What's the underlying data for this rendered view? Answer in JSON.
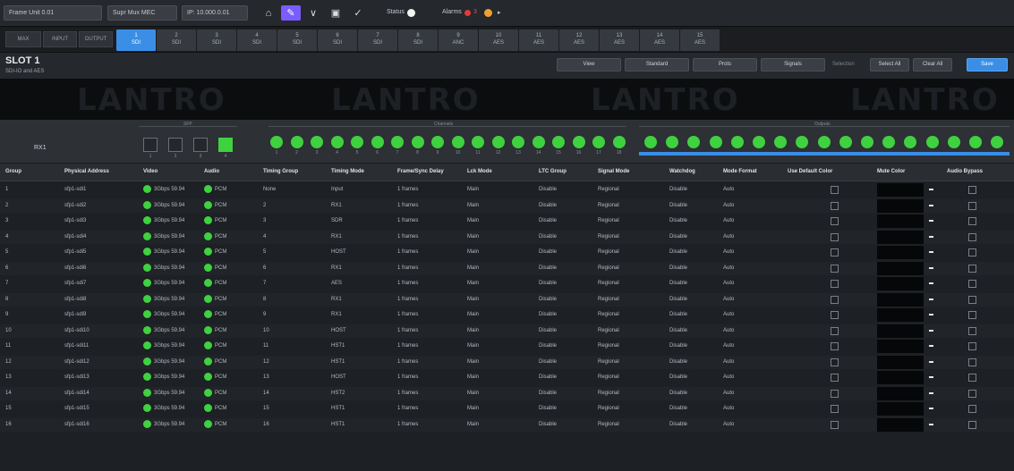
{
  "toolbar": {
    "device": "Frame Unit 0.01",
    "card": "Supr Mux MEC",
    "ip": "IP: 10.000.0.01",
    "status_label": "Status",
    "alarms_label": "Alarms",
    "alarm_count": "3",
    "buttons": [
      "home-icon",
      "pen-icon",
      "filter-icon",
      "camera-icon",
      "wrench-icon"
    ]
  },
  "inputs": {
    "left_buttons": [
      "MAX",
      "INPUT",
      "OUTPUT"
    ],
    "tabs": [
      {
        "num": "1",
        "label": "SDI"
      },
      {
        "num": "2",
        "label": "SDI"
      },
      {
        "num": "3",
        "label": "SDI"
      },
      {
        "num": "4",
        "label": "SDI"
      },
      {
        "num": "5",
        "label": "SDI"
      },
      {
        "num": "6",
        "label": "SDI"
      },
      {
        "num": "7",
        "label": "SDI"
      },
      {
        "num": "8",
        "label": "SDI"
      },
      {
        "num": "9",
        "label": "ANC"
      },
      {
        "num": "10",
        "label": "AES"
      },
      {
        "num": "11",
        "label": "AES"
      },
      {
        "num": "12",
        "label": "AES"
      },
      {
        "num": "13",
        "label": "AES"
      },
      {
        "num": "14",
        "label": "AES"
      },
      {
        "num": "15",
        "label": "AES"
      }
    ]
  },
  "slot": {
    "title": "SLOT 1",
    "subtitle": "SDI-IO and AES",
    "views": [
      "View",
      "Standard",
      "Prots",
      "Signals"
    ],
    "selection_label": "Selection",
    "select_all": "Select All",
    "clear_all": "Clear All",
    "apply": "Save"
  },
  "watermark": [
    "LANTRO",
    "LANTRO",
    "LANTRO",
    "LANTRO"
  ],
  "ports": {
    "rx_label": "RX1",
    "group_labels": [
      "SFP",
      "Channels",
      "Outputs"
    ],
    "sfp_count": 4,
    "sfp_active_index": 3,
    "channel_count": 18,
    "output_count": 17
  },
  "table": {
    "columns": [
      "Group",
      "Physical Address",
      "Video",
      "Audio",
      "Timing Group",
      "Timing Mode",
      "Frame/Sync Delay",
      "Lck Mode",
      "LTC Group",
      "Signal Mode",
      "Watchdog",
      "Mode Format",
      "Use Default Color",
      "Mute Color",
      "Audio Bypass"
    ],
    "rows": [
      {
        "group": "1",
        "addr": "sfp1-sdi1",
        "video": "3Gbps 59.94",
        "audio": "PCM",
        "tgroup": "None",
        "tmode": "Input",
        "fsd": "1 frames",
        "lck": "Main",
        "ltc": "Disable",
        "signal": "Regional",
        "watchdog": "Disable",
        "format": "Auto"
      },
      {
        "group": "2",
        "addr": "sfp1-sdi2",
        "video": "3Gbps 59.94",
        "audio": "PCM",
        "tgroup": "2",
        "tmode": "RX1",
        "fsd": "1 frames",
        "lck": "Main",
        "ltc": "Disable",
        "signal": "Regional",
        "watchdog": "Disable",
        "format": "Auto"
      },
      {
        "group": "3",
        "addr": "sfp1-sdi3",
        "video": "3Gbps 59.94",
        "audio": "PCM",
        "tgroup": "3",
        "tmode": "SDR",
        "fsd": "1 frames",
        "lck": "Main",
        "ltc": "Disable",
        "signal": "Regional",
        "watchdog": "Disable",
        "format": "Auto"
      },
      {
        "group": "4",
        "addr": "sfp1-sdi4",
        "video": "3Gbps 59.94",
        "audio": "PCM",
        "tgroup": "4",
        "tmode": "RX1",
        "fsd": "1 frames",
        "lck": "Main",
        "ltc": "Disable",
        "signal": "Regional",
        "watchdog": "Disable",
        "format": "Auto"
      },
      {
        "group": "5",
        "addr": "sfp1-sdi5",
        "video": "3Gbps 59.94",
        "audio": "PCM",
        "tgroup": "5",
        "tmode": "HOST",
        "fsd": "1 frames",
        "lck": "Main",
        "ltc": "Disable",
        "signal": "Regional",
        "watchdog": "Disable",
        "format": "Auto"
      },
      {
        "group": "6",
        "addr": "sfp1-sdi6",
        "video": "3Gbps 59.94",
        "audio": "PCM",
        "tgroup": "6",
        "tmode": "RX1",
        "fsd": "1 frames",
        "lck": "Main",
        "ltc": "Disable",
        "signal": "Regional",
        "watchdog": "Disable",
        "format": "Auto"
      },
      {
        "group": "7",
        "addr": "sfp1-sdi7",
        "video": "3Gbps 59.94",
        "audio": "PCM",
        "tgroup": "7",
        "tmode": "AES",
        "fsd": "1 frames",
        "lck": "Main",
        "ltc": "Disable",
        "signal": "Regional",
        "watchdog": "Disable",
        "format": "Auto"
      },
      {
        "group": "8",
        "addr": "sfp1-sdi8",
        "video": "3Gbps 59.94",
        "audio": "PCM",
        "tgroup": "8",
        "tmode": "RX1",
        "fsd": "1 frames",
        "lck": "Main",
        "ltc": "Disable",
        "signal": "Regional",
        "watchdog": "Disable",
        "format": "Auto"
      },
      {
        "group": "9",
        "addr": "sfp1-sdi9",
        "video": "3Gbps 59.94",
        "audio": "PCM",
        "tgroup": "9",
        "tmode": "RX1",
        "fsd": "1 frames",
        "lck": "Main",
        "ltc": "Disable",
        "signal": "Regional",
        "watchdog": "Disable",
        "format": "Auto"
      },
      {
        "group": "10",
        "addr": "sfp1-sdi10",
        "video": "3Gbps 59.94",
        "audio": "PCM",
        "tgroup": "10",
        "tmode": "HOST",
        "fsd": "1 frames",
        "lck": "Main",
        "ltc": "Disable",
        "signal": "Regional",
        "watchdog": "Disable",
        "format": "Auto"
      },
      {
        "group": "11",
        "addr": "sfp1-sdi11",
        "video": "3Gbps 59.94",
        "audio": "PCM",
        "tgroup": "11",
        "tmode": "HST1",
        "fsd": "1 frames",
        "lck": "Main",
        "ltc": "Disable",
        "signal": "Regional",
        "watchdog": "Disable",
        "format": "Auto"
      },
      {
        "group": "12",
        "addr": "sfp1-sdi12",
        "video": "3Gbps 59.94",
        "audio": "PCM",
        "tgroup": "12",
        "tmode": "HST1",
        "fsd": "1 frames",
        "lck": "Main",
        "ltc": "Disable",
        "signal": "Regional",
        "watchdog": "Disable",
        "format": "Auto"
      },
      {
        "group": "13",
        "addr": "sfp1-sdi13",
        "video": "3Gbps 59.94",
        "audio": "PCM",
        "tgroup": "13",
        "tmode": "HOST",
        "fsd": "1 frames",
        "lck": "Main",
        "ltc": "Disable",
        "signal": "Regional",
        "watchdog": "Disable",
        "format": "Auto"
      },
      {
        "group": "14",
        "addr": "sfp1-sdi14",
        "video": "3Gbps 59.94",
        "audio": "PCM",
        "tgroup": "14",
        "tmode": "HST2",
        "fsd": "1 frames",
        "lck": "Main",
        "ltc": "Disable",
        "signal": "Regional",
        "watchdog": "Disable",
        "format": "Auto"
      },
      {
        "group": "15",
        "addr": "sfp1-sdi15",
        "video": "3Gbps 59.94",
        "audio": "PCM",
        "tgroup": "15",
        "tmode": "HST1",
        "fsd": "1 frames",
        "lck": "Main",
        "ltc": "Disable",
        "signal": "Regional",
        "watchdog": "Disable",
        "format": "Auto"
      },
      {
        "group": "16",
        "addr": "sfp1-sdi16",
        "video": "3Gbps 59.94",
        "audio": "PCM",
        "tgroup": "16",
        "tmode": "HST1",
        "fsd": "1 frames",
        "lck": "Main",
        "ltc": "Disable",
        "signal": "Regional",
        "watchdog": "Disable",
        "format": "Auto"
      }
    ]
  },
  "colors": {
    "accent": "#3a8ee6",
    "ok": "#3fd13f",
    "active_tool": "#7b5cff"
  }
}
